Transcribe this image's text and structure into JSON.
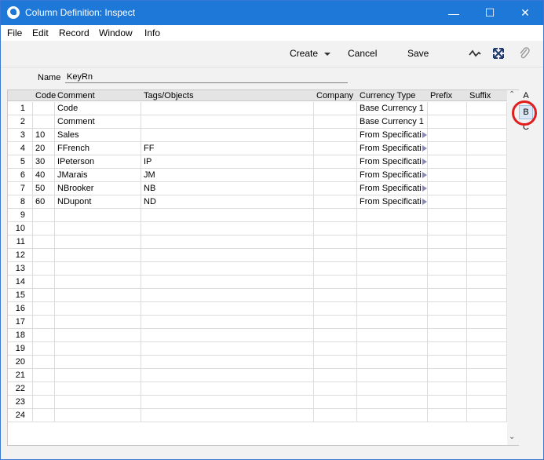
{
  "window": {
    "title": "Column Definition: Inspect",
    "controls": {
      "minimize": "—",
      "maximize": "☐",
      "close": "✕"
    }
  },
  "menu": [
    "File",
    "Edit",
    "Record",
    "Window",
    "Info"
  ],
  "toolbar": {
    "create_label": "Create",
    "cancel_label": "Cancel",
    "save_label": "Save",
    "icons": [
      "activity-icon",
      "expand-icon",
      "paperclip-icon"
    ]
  },
  "form": {
    "name_label": "Name",
    "name_value": "KeyRn"
  },
  "grid": {
    "columns": [
      "Code",
      "Comment",
      "Tags/Objects",
      "Company",
      "Currency Type",
      "Prefix",
      "Suffix"
    ],
    "rows": [
      {
        "num": "1",
        "code": "",
        "comment": "Code",
        "tags": "",
        "company": "",
        "currency": "Base Currency 1",
        "arrow": false
      },
      {
        "num": "2",
        "code": "",
        "comment": "Comment",
        "tags": "",
        "company": "",
        "currency": "Base Currency 1",
        "arrow": false
      },
      {
        "num": "3",
        "code": "10",
        "comment": "Sales",
        "tags": "",
        "company": "",
        "currency": "From Specificati",
        "arrow": true
      },
      {
        "num": "4",
        "code": "20",
        "comment": "FFrench",
        "tags": "FF",
        "company": "",
        "currency": "From Specificati",
        "arrow": true
      },
      {
        "num": "5",
        "code": "30",
        "comment": "IPeterson",
        "tags": "IP",
        "company": "",
        "currency": "From Specificati",
        "arrow": true
      },
      {
        "num": "6",
        "code": "40",
        "comment": "JMarais",
        "tags": "JM",
        "company": "",
        "currency": "From Specificati",
        "arrow": true
      },
      {
        "num": "7",
        "code": "50",
        "comment": "NBrooker",
        "tags": "NB",
        "company": "",
        "currency": "From Specificati",
        "arrow": true
      },
      {
        "num": "8",
        "code": "60",
        "comment": "NDupont",
        "tags": "ND",
        "company": "",
        "currency": "From Specificati",
        "arrow": true
      },
      {
        "num": "9"
      },
      {
        "num": "10"
      },
      {
        "num": "11"
      },
      {
        "num": "12"
      },
      {
        "num": "13"
      },
      {
        "num": "14"
      },
      {
        "num": "15"
      },
      {
        "num": "16"
      },
      {
        "num": "17"
      },
      {
        "num": "18"
      },
      {
        "num": "19"
      },
      {
        "num": "20"
      },
      {
        "num": "21"
      },
      {
        "num": "22"
      },
      {
        "num": "23"
      },
      {
        "num": "24"
      }
    ]
  },
  "tabs": [
    "A",
    "B",
    "C"
  ],
  "colors": {
    "titlebar": "#1e78d7",
    "highlight_ring": "#e01e1e",
    "selected_tab": "#dbe9f7"
  }
}
